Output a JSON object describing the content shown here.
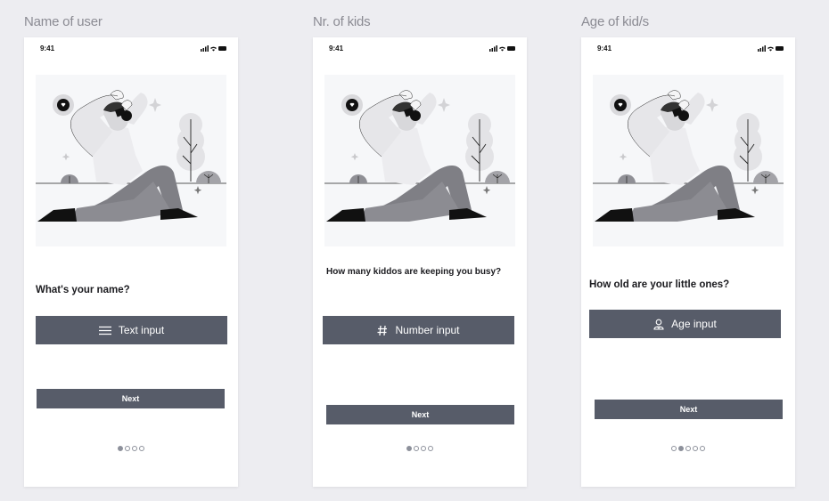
{
  "frames": [
    {
      "title": "Name of user",
      "status_time": "9:41",
      "question": "What's your name?",
      "input_label": "Text input",
      "input_icon": "menu-lines-icon",
      "next_label": "Next",
      "pager": {
        "total": 4,
        "active": 1
      }
    },
    {
      "title": "Nr. of kids",
      "status_time": "9:41",
      "question": "How many kiddos are keeping you busy?",
      "input_label": "Number input",
      "input_icon": "hash-icon",
      "next_label": "Next",
      "pager": {
        "total": 4,
        "active": 1
      }
    },
    {
      "title": "Age of kid/s",
      "status_time": "9:41",
      "question": "How old are your little ones?",
      "input_label": "Age input",
      "input_icon": "child-person-icon",
      "next_label": "Next",
      "pager": {
        "total": 5,
        "active": 2
      }
    }
  ],
  "colors": {
    "background": "#ededf1",
    "button": "#575c69",
    "dot": "#8d919b"
  }
}
